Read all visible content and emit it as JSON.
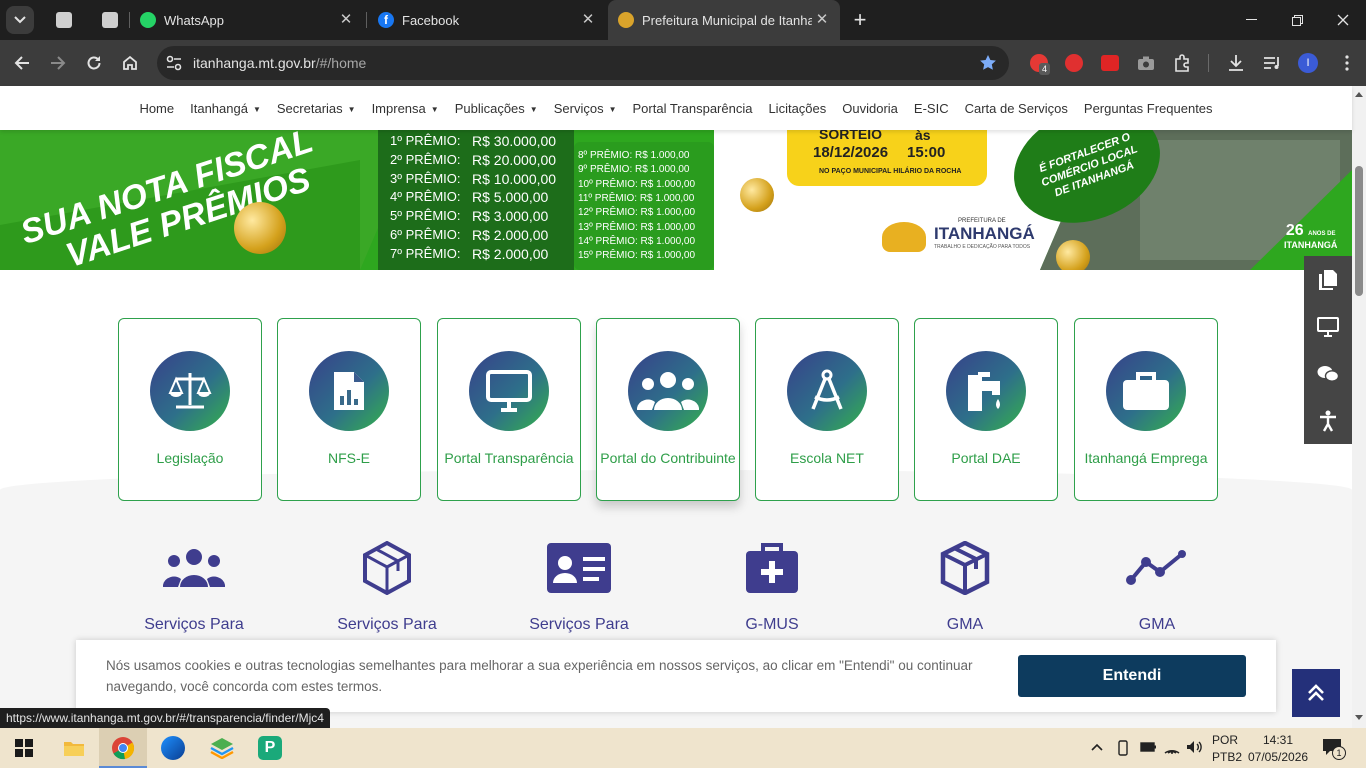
{
  "browser": {
    "tabs": [
      {
        "title": "WhatsApp"
      },
      {
        "title": "Facebook"
      },
      {
        "title": "Prefeitura Municipal de Itanhangá"
      }
    ],
    "new_tab": "+",
    "url_host": "itanhanga.mt.gov.br",
    "url_path": "/#/home",
    "ext_badge": "4",
    "profile_initial": "I"
  },
  "site_nav": {
    "items": [
      "Home",
      "Itanhangá",
      "Secretarias",
      "Imprensa",
      "Publicações",
      "Serviços",
      "Portal Transparência",
      "Licitações",
      "Ouvidoria",
      "E-SIC",
      "Carta de Serviços",
      "Perguntas Frequentes"
    ],
    "dropdown": [
      false,
      true,
      true,
      true,
      true,
      true,
      false,
      false,
      false,
      false,
      false,
      false
    ]
  },
  "banner": {
    "slogan_line1": "SUA NOTA FISCAL",
    "slogan_line2": "VALE PRÊMIOS",
    "prizes": [
      {
        "place": "1º PRÊMIO:",
        "value": "R$ 30.000,00"
      },
      {
        "place": "2º PRÊMIO:",
        "value": "R$ 20.000,00"
      },
      {
        "place": "3º PRÊMIO:",
        "value": "R$ 10.000,00"
      },
      {
        "place": "4º PRÊMIO:",
        "value": "R$ 5.000,00"
      },
      {
        "place": "5º PRÊMIO:",
        "value": "R$ 3.000,00"
      },
      {
        "place": "6º PRÊMIO:",
        "value": "R$ 2.000,00"
      },
      {
        "place": "7º PRÊMIO:",
        "value": "R$ 2.000,00"
      }
    ],
    "small_prizes": [
      "8º PRÊMIO: R$ 1.000,00",
      "9º PRÊMIO: R$ 1.000,00",
      "10º PRÊMIO: R$ 1.000,00",
      "11º PRÊMIO: R$ 1.000,00",
      "12º PRÊMIO: R$ 1.000,00",
      "13º PRÊMIO: R$ 1.000,00",
      "14º PRÊMIO: R$ 1.000,00",
      "15º PRÊMIO: R$ 1.000,00"
    ],
    "sorteio_label": "SORTEIO",
    "sorteio_date": "18/12/2026",
    "sorteio_as": "às",
    "sorteio_time": "15:00",
    "sorteio_place": "NO PAÇO MUNICIPAL HILÁRIO DA ROCHA",
    "badge_text": "É FORTALECER O COMÉRCIO LOCAL DE ITANHANGÁ",
    "logo_small": "PREFEITURA DE",
    "logo_big": "ITANHANGÁ",
    "logo_tag": "TRABALHO E DEDICAÇÃO PARA TODOS",
    "anniv_num": "26",
    "anniv_small": "ANOS DE",
    "anniv_name": "ITANHANGÁ"
  },
  "quick_cards": [
    {
      "label": "Legislação",
      "icon": "scale-icon"
    },
    {
      "label": "NFS-E",
      "icon": "document-chart-icon"
    },
    {
      "label": "Portal Transparência",
      "icon": "monitor-icon"
    },
    {
      "label": "Portal do Contribuinte",
      "icon": "users-icon"
    },
    {
      "label": "Escola NET",
      "icon": "compass-icon"
    },
    {
      "label": "Portal DAE",
      "icon": "faucet-icon"
    },
    {
      "label": "Itanhangá Emprega",
      "icon": "briefcase-icon"
    }
  ],
  "services": [
    {
      "label": "Serviços Para",
      "icon": "users-icon"
    },
    {
      "label": "Serviços Para",
      "icon": "cube-icon"
    },
    {
      "label": "Serviços Para",
      "icon": "id-card-icon"
    },
    {
      "label": "G-MUS",
      "icon": "medkit-icon"
    },
    {
      "label": "GMA",
      "icon": "box-icon"
    },
    {
      "label": "GMA",
      "icon": "line-chart-icon"
    }
  ],
  "cookie": {
    "text": "Nós usamos cookies e outras tecnologias semelhantes para melhorar a sua experiência em nossos serviços, ao clicar em \"Entendi\" ou continuar navegando, você concorda com estes termos.",
    "button": "Entendi"
  },
  "status_url": "https://www.itanhanga.mt.gov.br/#/transparencia/finder/Mjc4",
  "taskbar": {
    "lang1": "POR",
    "lang2": "PTB2",
    "time": "14:31",
    "date": "07/05/2026",
    "notif_count": "1"
  },
  "colors": {
    "brand_green": "#2ea14c",
    "brand_blue": "#3f3d8e",
    "cookie_button": "#0d3b5e",
    "scroll_top_button": "#24307a"
  }
}
